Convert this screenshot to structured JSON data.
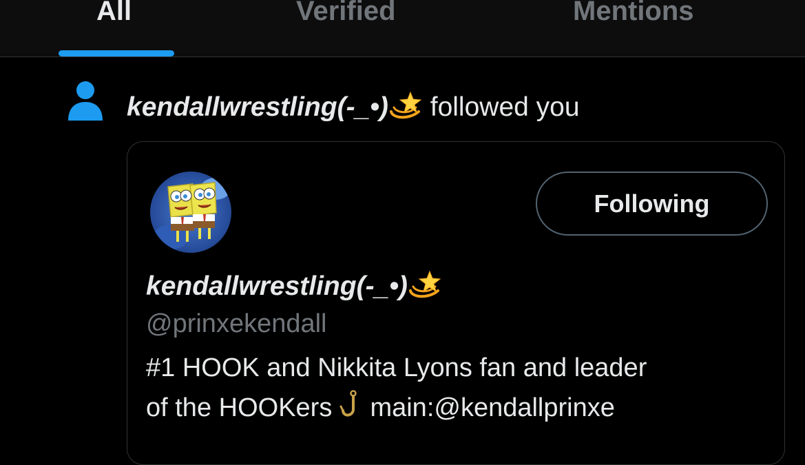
{
  "tabs": [
    {
      "label": "All",
      "active": true
    },
    {
      "label": "Verified",
      "active": false
    },
    {
      "label": "Mentions",
      "active": false
    }
  ],
  "accent_color": "#1d9bf0",
  "notification": {
    "icon": "person-icon",
    "actor_name": "kendallwrestling(-_•)",
    "actor_emoji": "dizzy-star-emoji",
    "action_text": "followed you"
  },
  "profile_card": {
    "avatar": "spongebob-avatar",
    "follow_button_label": "Following",
    "display_name": "kendallwrestling(-_•)",
    "display_name_emoji": "dizzy-star-emoji",
    "handle": "@prinxekendall",
    "bio_line_1": "#1 HOOK and Nikkita Lyons fan and leader",
    "bio_line_2_prefix": "of the HOOKers",
    "bio_emoji": "hook-emoji",
    "bio_line_2_suffix": "main:@kendallprinxe"
  }
}
